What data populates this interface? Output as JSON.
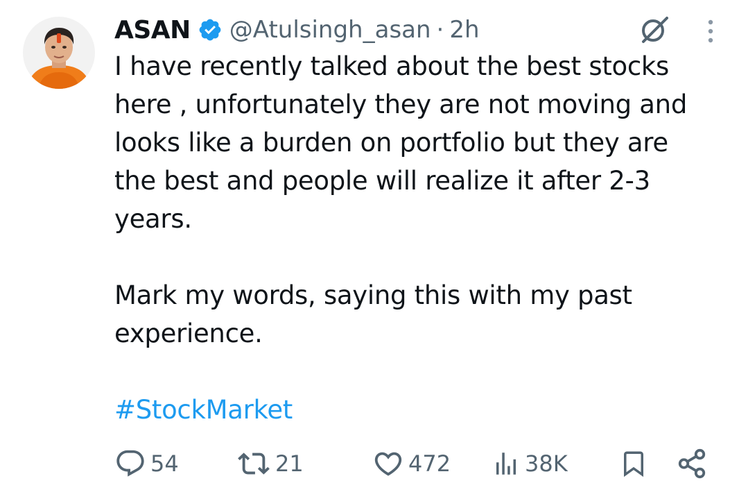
{
  "tweet": {
    "author": {
      "display_name": "ASAN",
      "handle": "@Atulsingh_asan",
      "verified": true,
      "avatar": "avatar-photo"
    },
    "separator": "·",
    "time": "2h",
    "body": {
      "paragraph_1": "I have recently talked about the best stocks here , unfortunately they are not moving and looks like a burden on portfolio but they are the best and people will realize it after 2-3 years.",
      "paragraph_2": "Mark my words, saying this with my past experience.",
      "hashtag": "#StockMarket"
    },
    "icons": {
      "verified": "verified-badge-icon",
      "grok": "grok-icon",
      "more": "more-vertical-icon"
    },
    "actions": {
      "replies": "54",
      "reposts": "21",
      "likes": "472",
      "views": "38K"
    },
    "colors": {
      "text": "#0f1419",
      "secondary": "#536471",
      "accent": "#1d9bf0"
    }
  }
}
